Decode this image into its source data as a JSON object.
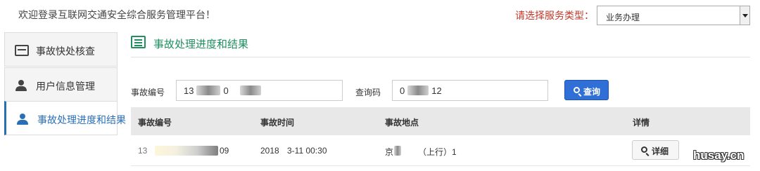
{
  "header": {
    "welcome": "欢迎登录互联网交通安全综合服务管理平台！",
    "service_type_label": "请选择服务类型：",
    "service_type_value": "业务办理"
  },
  "sidebar": {
    "items": [
      {
        "label": "事故快处核查",
        "icon": "card-icon",
        "active": false
      },
      {
        "label": "用户信息管理",
        "icon": "user-icon",
        "active": false
      },
      {
        "label": "事故处理进度和结果",
        "icon": "user-icon",
        "active": true
      }
    ]
  },
  "main": {
    "title": "事故处理进度和结果",
    "form": {
      "accident_no_label": "事故编号",
      "accident_no_value_start": "13",
      "accident_no_value_mid": "0",
      "query_code_label": "查询码",
      "query_code_value_start": "0",
      "query_code_value_end": "12",
      "search_button": "查询"
    },
    "table": {
      "columns": [
        "事故编号",
        "事故时间",
        "事故地点",
        "详情"
      ],
      "rows": [
        {
          "accident_no_start": "13",
          "accident_no_end": "09",
          "time_start": "2018",
          "time_end": "3-11 00:30",
          "location_start": "京",
          "location_end": "（上行）1",
          "detail_button": "详细"
        }
      ]
    }
  },
  "watermark": "husay.cn",
  "colors": {
    "accent_blue": "#2a6fb6",
    "title_green": "#1f8f5f",
    "label_red": "#c0392b",
    "button_blue": "#2f6fd6"
  }
}
